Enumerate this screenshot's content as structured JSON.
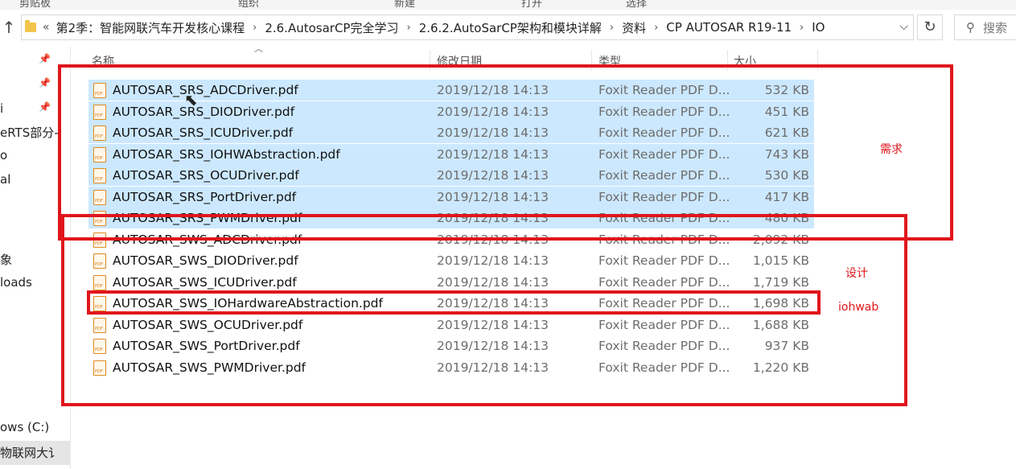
{
  "ribbon": {
    "labels": [
      "剪贴板",
      "组织",
      "新建",
      "打开",
      "选择"
    ]
  },
  "address": {
    "lead": "«",
    "crumbs": [
      "第2季：智能网联汽车开发核心课程",
      "2.6.AutosarCP完全学习",
      "2.6.2.AutoSarCP架构和模块详解",
      "资料",
      "CP AUTOSAR R19-11",
      "IO"
    ],
    "separator": "›"
  },
  "search": {
    "placeholder": "搜索"
  },
  "navpane": {
    "items": [
      {
        "label": "i"
      },
      {
        "label": "eRTS部分-"
      },
      {
        "label": "o"
      },
      {
        "label": "al"
      },
      {
        "label": "象"
      },
      {
        "label": "loads"
      },
      {
        "label": "ows (C:)"
      },
      {
        "label": "物联网大讠"
      }
    ]
  },
  "columns": {
    "name": "名称",
    "modified": "修改日期",
    "type": "类型",
    "size": "大小"
  },
  "files": [
    {
      "name": "AUTOSAR_SRS_ADCDriver.pdf",
      "date": "2019/12/18 14:13",
      "type": "Foxit Reader PDF D...",
      "size": "532 KB",
      "selected": true
    },
    {
      "name": "AUTOSAR_SRS_DIODriver.pdf",
      "date": "2019/12/18 14:13",
      "type": "Foxit Reader PDF D...",
      "size": "451 KB",
      "selected": true
    },
    {
      "name": "AUTOSAR_SRS_ICUDriver.pdf",
      "date": "2019/12/18 14:13",
      "type": "Foxit Reader PDF D...",
      "size": "621 KB",
      "selected": true
    },
    {
      "name": "AUTOSAR_SRS_IOHWAbstraction.pdf",
      "date": "2019/12/18 14:13",
      "type": "Foxit Reader PDF D...",
      "size": "743 KB",
      "selected": true
    },
    {
      "name": "AUTOSAR_SRS_OCUDriver.pdf",
      "date": "2019/12/18 14:13",
      "type": "Foxit Reader PDF D...",
      "size": "530 KB",
      "selected": true
    },
    {
      "name": "AUTOSAR_SRS_PortDriver.pdf",
      "date": "2019/12/18 14:13",
      "type": "Foxit Reader PDF D...",
      "size": "417 KB",
      "selected": true
    },
    {
      "name": "AUTOSAR_SRS_PWMDriver.pdf",
      "date": "2019/12/18 14:13",
      "type": "Foxit Reader PDF D...",
      "size": "480 KB",
      "selected": true
    },
    {
      "name": "AUTOSAR_SWS_ADCDriver.pdf",
      "date": "2019/12/18 14:13",
      "type": "Foxit Reader PDF D...",
      "size": "2,092 KB",
      "selected": false
    },
    {
      "name": "AUTOSAR_SWS_DIODriver.pdf",
      "date": "2019/12/18 14:13",
      "type": "Foxit Reader PDF D...",
      "size": "1,015 KB",
      "selected": false
    },
    {
      "name": "AUTOSAR_SWS_ICUDriver.pdf",
      "date": "2019/12/18 14:13",
      "type": "Foxit Reader PDF D...",
      "size": "1,719 KB",
      "selected": false
    },
    {
      "name": "AUTOSAR_SWS_IOHardwareAbstraction.pdf",
      "date": "2019/12/18 14:13",
      "type": "Foxit Reader PDF D...",
      "size": "1,698 KB",
      "selected": false
    },
    {
      "name": "AUTOSAR_SWS_OCUDriver.pdf",
      "date": "2019/12/18 14:13",
      "type": "Foxit Reader PDF D...",
      "size": "1,688 KB",
      "selected": false
    },
    {
      "name": "AUTOSAR_SWS_PortDriver.pdf",
      "date": "2019/12/18 14:13",
      "type": "Foxit Reader PDF D...",
      "size": "937 KB",
      "selected": false
    },
    {
      "name": "AUTOSAR_SWS_PWMDriver.pdf",
      "date": "2019/12/18 14:13",
      "type": "Foxit Reader PDF D...",
      "size": "1,220 KB",
      "selected": false
    }
  ],
  "annotations": {
    "requirements": "需求",
    "design": "设计",
    "iohwab": "iohwab"
  },
  "colors": {
    "selection": "#cce8ff",
    "annotation_red": "#e0161c"
  }
}
